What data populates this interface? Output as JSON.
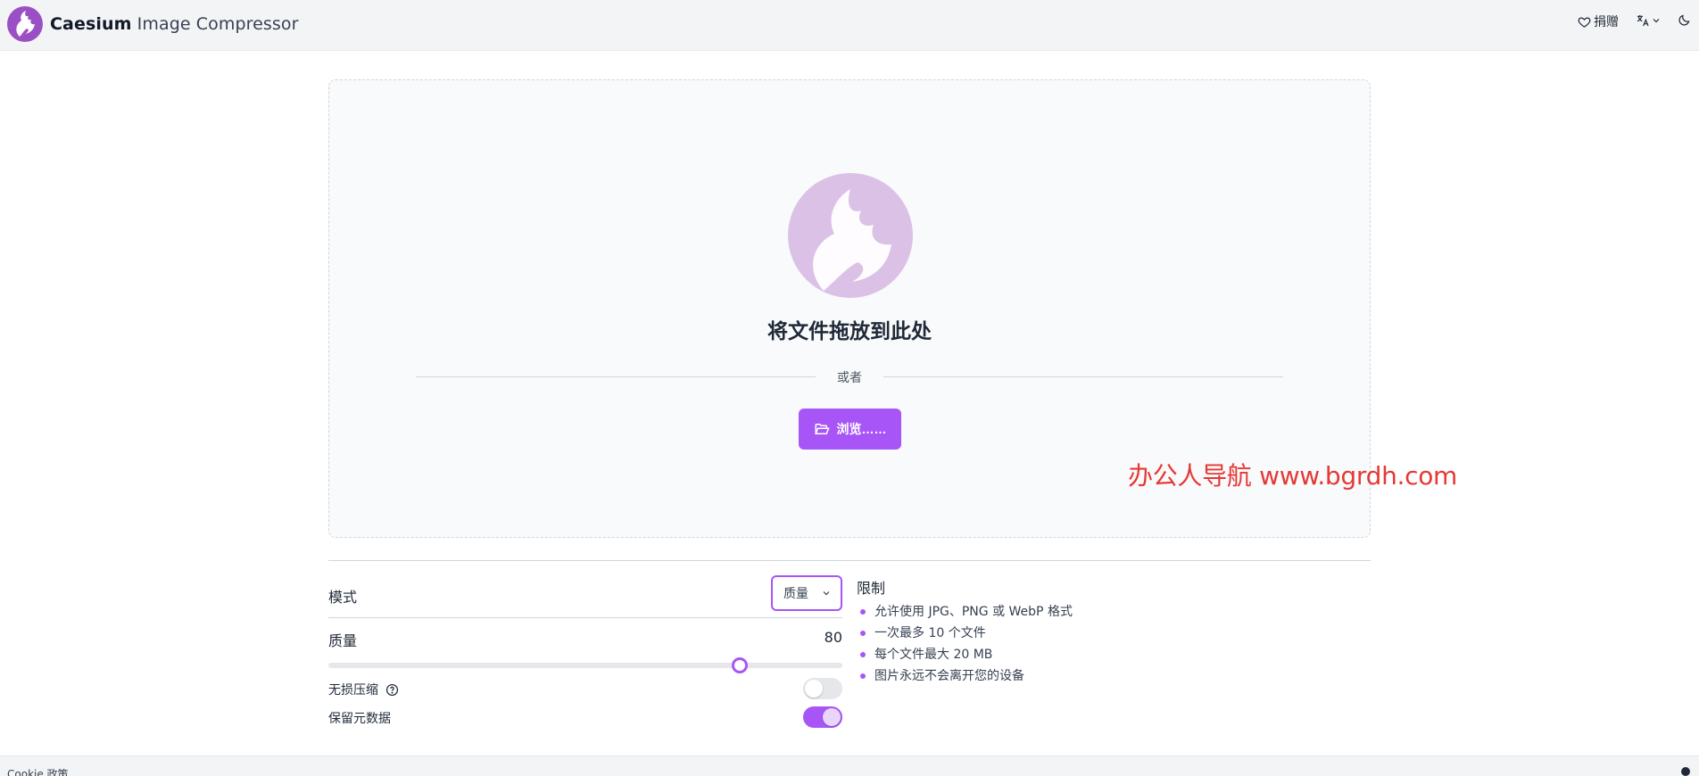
{
  "app": {
    "title_bold": "Caesium",
    "title_rest": "Image Compressor"
  },
  "header": {
    "donate_label": "捐赠",
    "language_icon": "translate-icon",
    "theme_icon": "moon-icon"
  },
  "dropzone": {
    "title": "将文件拖放到此处",
    "or_text": "或者",
    "browse_label": "浏览……"
  },
  "watermark": "办公人导航 www.bgrdh.com",
  "options": {
    "mode_label": "模式",
    "mode_value": "质量",
    "quality_label": "质量",
    "quality_value": "80",
    "quality_fraction": 0.8,
    "lossless_label": "无损压缩",
    "lossless_on": false,
    "keep_metadata_label": "保留元数据",
    "keep_metadata_on": true
  },
  "limits": {
    "title": "限制",
    "items": [
      "允许使用 JPG、PNG 或 WebP 格式",
      "一次最多 10 个文件",
      "每个文件最大 20 MB",
      "图片永远不会离开您的设备"
    ]
  },
  "footer": {
    "cookie_label": "Cookie 政策"
  },
  "colors": {
    "accent": "#a855f7",
    "brand": "#9b4fc4",
    "watermark": "#e53935"
  }
}
